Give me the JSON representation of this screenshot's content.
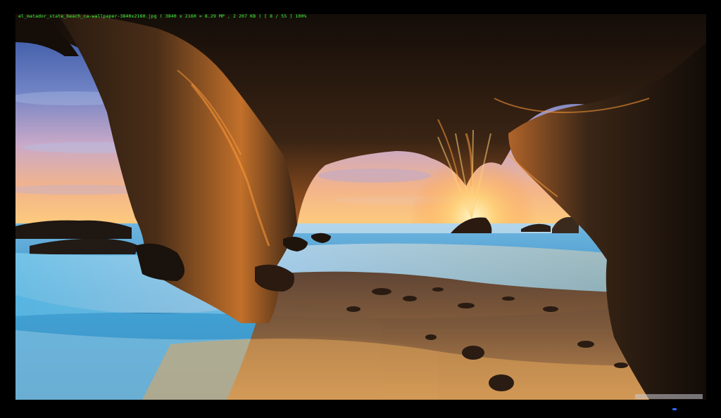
{
  "viewer": {
    "info_line": "el_matador_state_beach_ca-wallpaper-3840x2160.jpg  ( 3840 x 2160 = 8.29 MP ,  2 207 KB )  [ 8 / 55 ]   100%",
    "image_subject": "sea-cave-sunset-photo"
  },
  "colors": {
    "info_text": "#3dff3d",
    "background": "#000000",
    "sun": "#ffd27a",
    "rock": "#2a1a10",
    "sky_top": "#3a5aa8",
    "water": "#4aa8d8"
  }
}
